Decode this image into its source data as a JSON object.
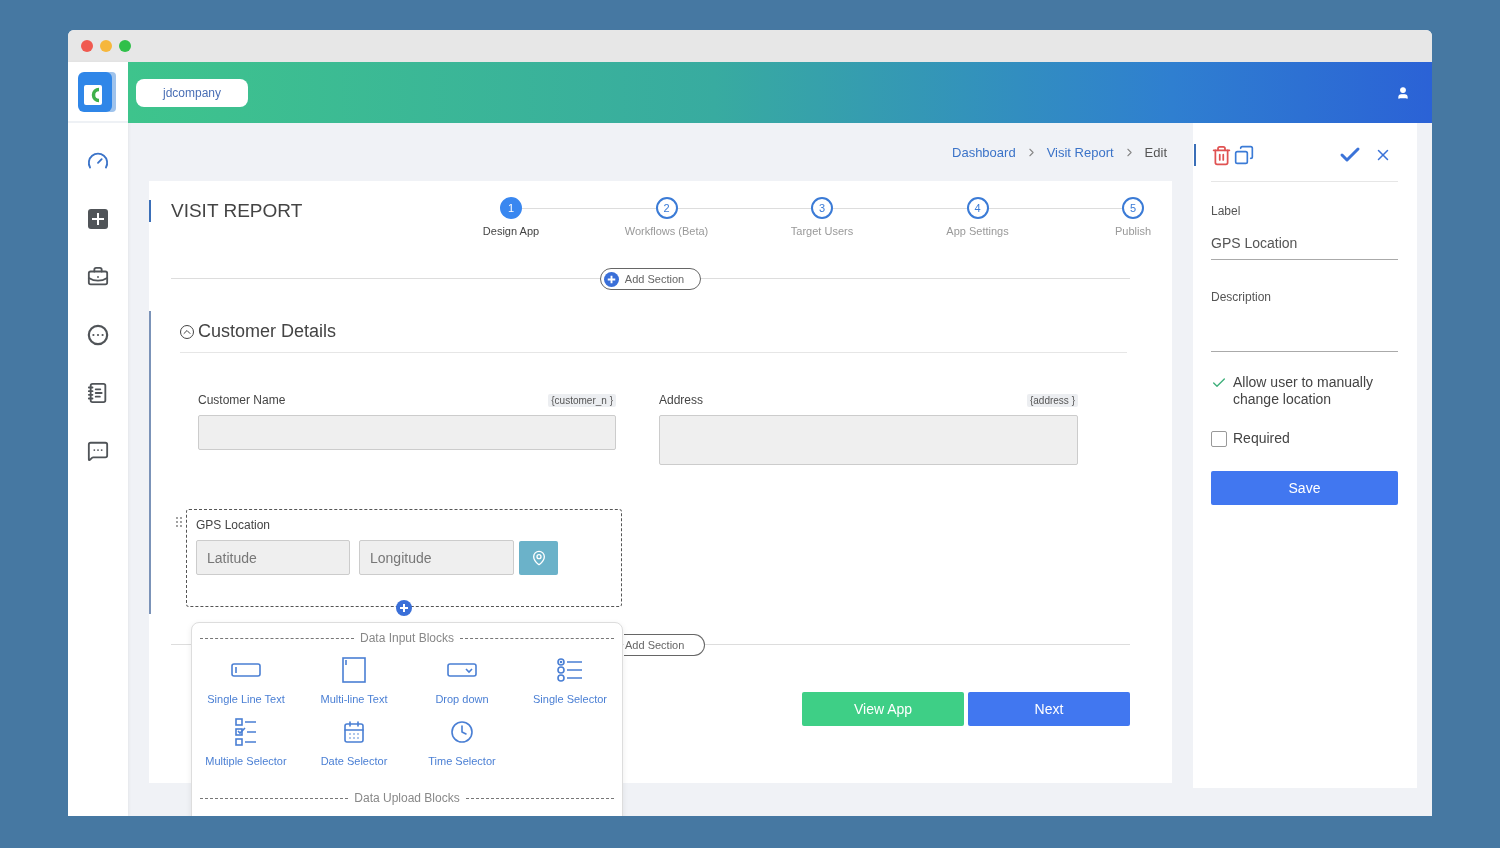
{
  "header": {
    "workspace": "jdcompany"
  },
  "breadcrumb": [
    {
      "label": "Dashboard",
      "kind": "link"
    },
    {
      "label": "Visit Report",
      "kind": "link"
    },
    {
      "label": "Edit",
      "kind": "current"
    }
  ],
  "page_title": "VISIT REPORT",
  "steps": [
    {
      "number": "1",
      "label": "Design App",
      "selected": true
    },
    {
      "number": "2",
      "label": "Workflows (Beta)",
      "selected": false
    },
    {
      "number": "3",
      "label": "Target Users",
      "selected": false
    },
    {
      "number": "4",
      "label": "App Settings",
      "selected": false
    },
    {
      "number": "5",
      "label": "Publish",
      "selected": false
    }
  ],
  "add_section": [
    "Add Section",
    "Add Section"
  ],
  "section": {
    "title": "Customer Details",
    "expanded": true,
    "fields": [
      {
        "label": "Customer Name",
        "tag": "{customer_n }",
        "kind": "text"
      },
      {
        "label": "Address",
        "tag": "{address }",
        "kind": "textarea"
      }
    ],
    "gps_field": {
      "label": "GPS Location",
      "latitude_placeholder": "Latitude",
      "longitude_placeholder": "Longitude"
    }
  },
  "block_menu": {
    "groups": [
      {
        "title": "Data Input Blocks",
        "items": [
          {
            "label": "Single Line Text",
            "kind": "single-line"
          },
          {
            "label": "Multi-line Text",
            "kind": "multi-line"
          },
          {
            "label": "Drop down",
            "kind": "dropdown"
          },
          {
            "label": "Single Selector",
            "kind": "single-select"
          },
          {
            "label": "Multiple Selector",
            "kind": "multi-select"
          },
          {
            "label": "Date Selector",
            "kind": "date"
          },
          {
            "label": "Time Selector",
            "kind": "time"
          }
        ]
      },
      {
        "title": "Data Upload Blocks"
      }
    ]
  },
  "actions": [
    {
      "label": "View App",
      "kind": "secondary"
    },
    {
      "label": "Next",
      "kind": "primary"
    }
  ],
  "properties_panel": {
    "label_caption": "Label",
    "label_value": "GPS Location",
    "description_caption": "Description",
    "options": [
      {
        "label": "Allow user to manually change location",
        "checked": true
      },
      {
        "label": "Required",
        "checked": false
      }
    ],
    "save": "Save"
  }
}
